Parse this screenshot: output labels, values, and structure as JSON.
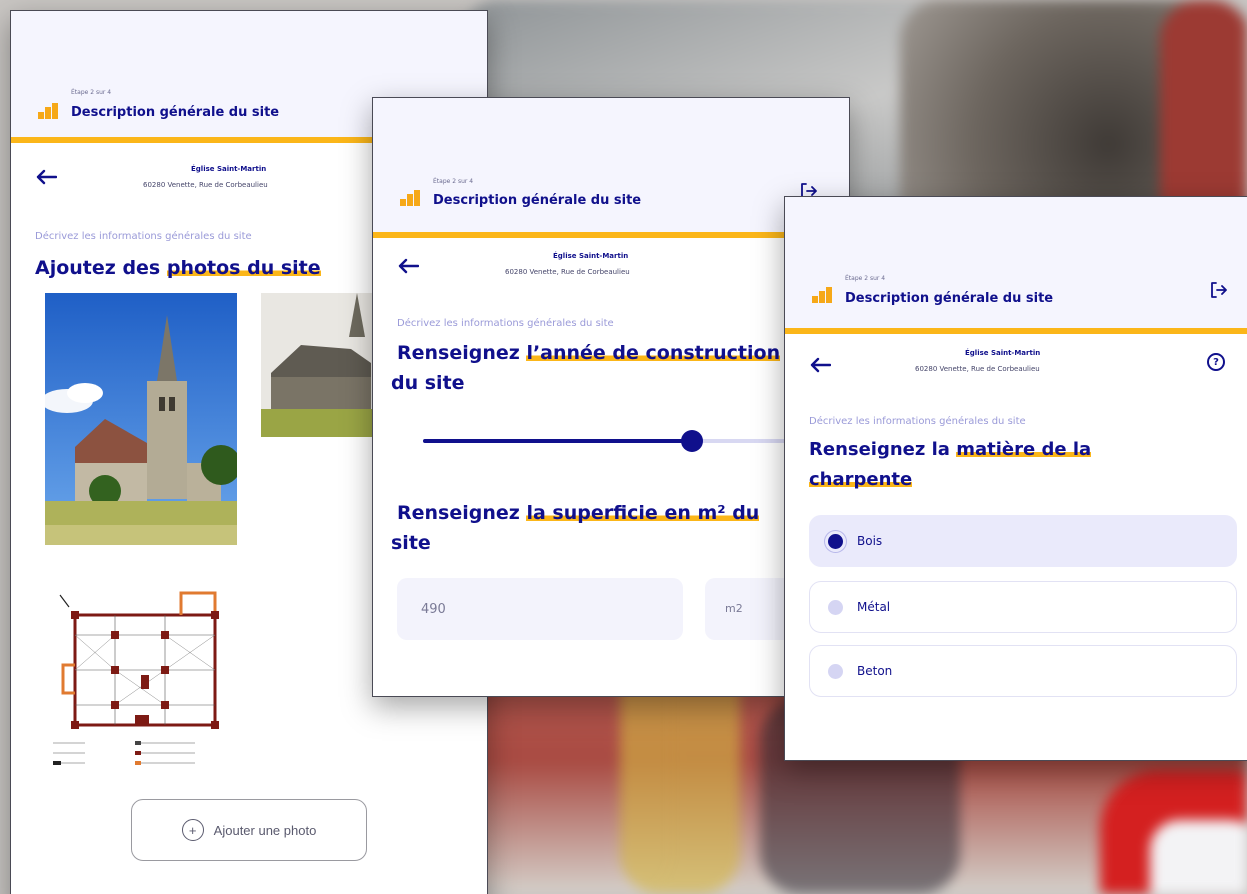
{
  "common": {
    "step": "Étape 2 sur 4",
    "title": "Description générale du site",
    "site_name": "Église Saint-Martin",
    "site_address": "60280 Venette, Rue de Corbeaulieu",
    "subtitle": "Décrivez les informations générales du site"
  },
  "screen1": {
    "heading_plain": "Ajoutez des ",
    "heading_highlight": "photos du site",
    "add_photo_label": "Ajouter une photo"
  },
  "screen2": {
    "q1_plain": "Renseignez ",
    "q1_highlight": "l’année de construction",
    "q1_rest": " du site",
    "slider_progress": 0.64,
    "q2_plain": "Renseignez ",
    "q2_highlight": "la superficie en m² du",
    "q2_rest": " site",
    "area_value": "490",
    "unit": "m2"
  },
  "screen3": {
    "heading_plain": "Renseignez la ",
    "heading_highlight": "matière de la charpente",
    "options": [
      {
        "label": "Bois",
        "selected": true
      },
      {
        "label": "Métal",
        "selected": false
      },
      {
        "label": "Beton",
        "selected": false
      }
    ]
  },
  "colors": {
    "primary": "#10108c",
    "accent": "#fbb619",
    "subtitle": "#9a9ad8"
  },
  "icons": [
    "church-logo-icon",
    "exit-icon",
    "back-arrow-icon",
    "help-icon",
    "plus-icon"
  ]
}
